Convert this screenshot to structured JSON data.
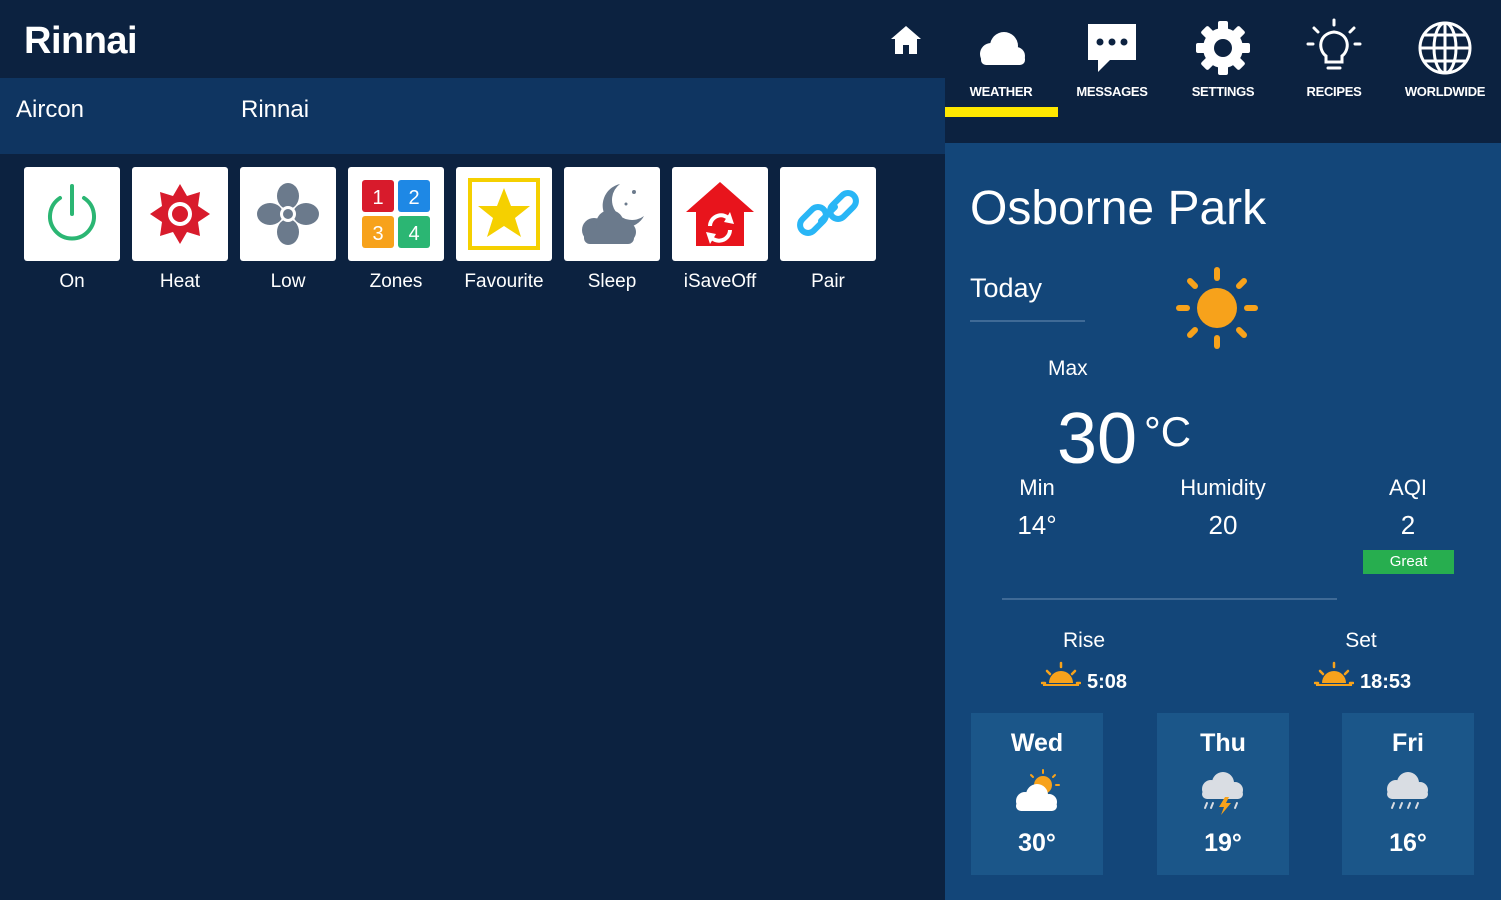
{
  "header": {
    "brand": "Rinnai",
    "home_icon": "home-icon"
  },
  "subbar": {
    "device_type": "Aircon",
    "device_name": "Rinnai"
  },
  "controls": [
    {
      "label": "On",
      "icon": "power-icon"
    },
    {
      "label": "Heat",
      "icon": "heat-sun-icon"
    },
    {
      "label": "Low",
      "icon": "fan-icon"
    },
    {
      "label": "Zones",
      "icon": "zones-grid-icon"
    },
    {
      "label": "Favourite",
      "icon": "star-icon"
    },
    {
      "label": "Sleep",
      "icon": "moon-cloud-icon"
    },
    {
      "label": "iSaveOff",
      "icon": "isave-house-icon"
    },
    {
      "label": "Pair",
      "icon": "link-icon"
    }
  ],
  "zones_icon_numbers": [
    "1",
    "2",
    "3",
    "4"
  ],
  "nav": [
    {
      "label": "WEATHER",
      "icon": "cloud-icon",
      "active": true
    },
    {
      "label": "MESSAGES",
      "icon": "chat-icon",
      "active": false
    },
    {
      "label": "SETTINGS",
      "icon": "gear-icon",
      "active": false
    },
    {
      "label": "RECIPES",
      "icon": "lightbulb-icon",
      "active": false
    },
    {
      "label": "WORLDWIDE",
      "icon": "globe-icon",
      "active": false
    }
  ],
  "weather": {
    "city": "Osborne Park",
    "today_label": "Today",
    "today_icon": "sun-icon",
    "max_label": "Max",
    "max_temp": "30",
    "unit": "°C",
    "min_label": "Min",
    "min_value": "14°",
    "humidity_label": "Humidity",
    "humidity_value": "20",
    "aqi_label": "AQI",
    "aqi_value": "2",
    "aqi_status": "Great",
    "rise_label": "Rise",
    "rise_time": "5:08",
    "set_label": "Set",
    "set_time": "18:53",
    "forecast": [
      {
        "day": "Wed",
        "temp": "30°",
        "icon": "partly-cloudy-icon"
      },
      {
        "day": "Thu",
        "temp": "19°",
        "icon": "thunder-rain-icon"
      },
      {
        "day": "Fri",
        "temp": "16°",
        "icon": "rain-cloud-icon"
      }
    ]
  },
  "colors": {
    "background": "#0c2240",
    "subbar": "#0f3561",
    "weather_panel": "#134679",
    "forecast_card": "#1b5689",
    "active_underline": "#ffe800",
    "aqi_great": "#27ae4f",
    "sun": "#f7a21b",
    "power_green": "#2bb673",
    "heat_red": "#d81b2c"
  }
}
